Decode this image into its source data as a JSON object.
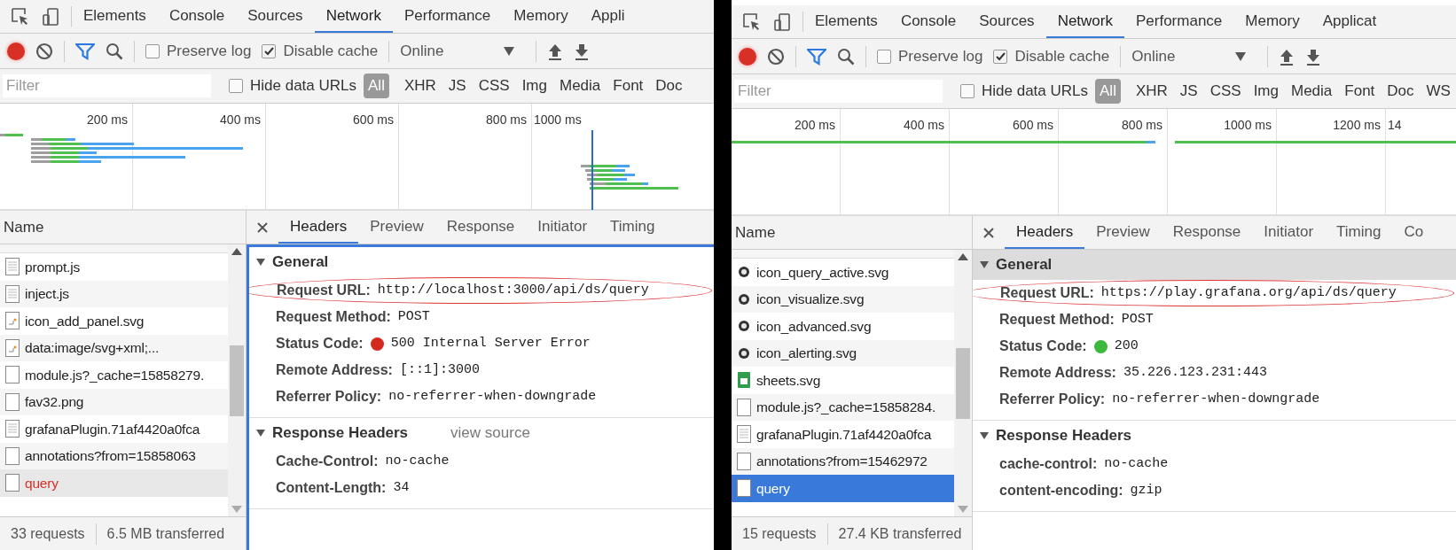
{
  "panels": [
    {
      "tabs": [
        {
          "label": "Elements",
          "selected": false
        },
        {
          "label": "Console",
          "selected": false
        },
        {
          "label": "Sources",
          "selected": false
        },
        {
          "label": "Network",
          "selected": true
        },
        {
          "label": "Performance",
          "selected": false
        },
        {
          "label": "Memory",
          "selected": false
        },
        {
          "label": "Appli",
          "selected": false
        }
      ],
      "toolbar": {
        "recording": true,
        "preserve_log": {
          "label": "Preserve log",
          "checked": false
        },
        "disable_cache": {
          "label": "Disable cache",
          "checked": true
        },
        "throttling": "Online"
      },
      "filter": {
        "placeholder": "Filter",
        "hide_data_urls": {
          "label": "Hide data URLs",
          "checked": false
        },
        "types": [
          {
            "label": "All",
            "selected": true
          },
          {
            "label": "XHR",
            "selected": false
          },
          {
            "label": "JS",
            "selected": false
          },
          {
            "label": "CSS",
            "selected": false
          },
          {
            "label": "Img",
            "selected": false
          },
          {
            "label": "Media",
            "selected": false
          },
          {
            "label": "Font",
            "selected": false
          },
          {
            "label": "Doc",
            "selected": false
          }
        ]
      },
      "timeline": {
        "ticks": [
          "200 ms",
          "400 ms",
          "600 ms",
          "800 ms",
          "1000 ms"
        ]
      },
      "requests": {
        "header": "Name",
        "focused": false,
        "rows": [
          {
            "name": "prompt.js",
            "kind": "script",
            "selected": false,
            "error": false
          },
          {
            "name": "inject.js",
            "kind": "script",
            "selected": false,
            "error": false
          },
          {
            "name": "icon_add_panel.svg",
            "kind": "image",
            "selected": false,
            "error": false
          },
          {
            "name": "data:image/svg+xml;...",
            "kind": "image",
            "selected": false,
            "error": false
          },
          {
            "name": "module.js?_cache=15858279.",
            "kind": "blank",
            "selected": false,
            "error": false
          },
          {
            "name": "fav32.png",
            "kind": "blank",
            "selected": false,
            "error": false
          },
          {
            "name": "grafanaPlugin.71af4420a0fca",
            "kind": "script",
            "selected": false,
            "error": false
          },
          {
            "name": "annotations?from=15858063",
            "kind": "blank",
            "selected": false,
            "error": false
          },
          {
            "name": "query",
            "kind": "blank",
            "selected": true,
            "error": true
          }
        ]
      },
      "footer": [
        "33 requests",
        "6.5 MB transferred"
      ],
      "details": {
        "tabs": [
          {
            "label": "Headers",
            "selected": true
          },
          {
            "label": "Preview",
            "selected": false
          },
          {
            "label": "Response",
            "selected": false
          },
          {
            "label": "Initiator",
            "selected": false
          },
          {
            "label": "Timing",
            "selected": false
          }
        ],
        "sections": [
          {
            "title": "General",
            "expanded": true,
            "highlighted": false,
            "fields": [
              {
                "label": "Request URL:",
                "value": "http://localhost:3000/api/ds/query",
                "circled": true
              },
              {
                "label": "Request Method:",
                "value": "POST",
                "circled": false
              },
              {
                "label": "Status Code:",
                "value": "500 Internal Server Error",
                "circled": false,
                "color": "#d42a1e"
              },
              {
                "label": "Remote Address:",
                "value": "[::1]:3000",
                "circled": false
              },
              {
                "label": "Referrer Policy:",
                "value": "no-referrer-when-downgrade",
                "circled": false
              }
            ]
          },
          {
            "title": "Response Headers",
            "expanded": true,
            "highlighted": false,
            "link": "view source",
            "fields": [
              {
                "label": "Cache-Control:",
                "value": "no-cache",
                "circled": false
              },
              {
                "label": "Content-Length:",
                "value": "34",
                "circled": false
              }
            ]
          }
        ]
      }
    },
    {
      "tabs": [
        {
          "label": "Elements",
          "selected": false
        },
        {
          "label": "Console",
          "selected": false
        },
        {
          "label": "Sources",
          "selected": false
        },
        {
          "label": "Network",
          "selected": true
        },
        {
          "label": "Performance",
          "selected": false
        },
        {
          "label": "Memory",
          "selected": false
        },
        {
          "label": "Applicat",
          "selected": false
        }
      ],
      "toolbar": {
        "recording": true,
        "preserve_log": {
          "label": "Preserve log",
          "checked": false
        },
        "disable_cache": {
          "label": "Disable cache",
          "checked": true
        },
        "throttling": "Online"
      },
      "filter": {
        "placeholder": "Filter",
        "hide_data_urls": {
          "label": "Hide data URLs",
          "checked": false
        },
        "types": [
          {
            "label": "All",
            "selected": true
          },
          {
            "label": "XHR",
            "selected": false
          },
          {
            "label": "JS",
            "selected": false
          },
          {
            "label": "CSS",
            "selected": false
          },
          {
            "label": "Img",
            "selected": false
          },
          {
            "label": "Media",
            "selected": false
          },
          {
            "label": "Font",
            "selected": false
          },
          {
            "label": "Doc",
            "selected": false
          },
          {
            "label": "WS",
            "selected": false
          }
        ]
      },
      "timeline": {
        "ticks": [
          "200 ms",
          "400 ms",
          "600 ms",
          "800 ms",
          "1000 ms",
          "1200 ms",
          "14"
        ]
      },
      "requests": {
        "header": "Name",
        "focused": true,
        "rows": [
          {
            "name": "icon_query_active.svg",
            "kind": "dot",
            "selected": false,
            "error": false
          },
          {
            "name": "icon_visualize.svg",
            "kind": "dot",
            "selected": false,
            "error": false
          },
          {
            "name": "icon_advanced.svg",
            "kind": "dot",
            "selected": false,
            "error": false
          },
          {
            "name": "icon_alerting.svg",
            "kind": "dot",
            "selected": false,
            "error": false
          },
          {
            "name": "sheets.svg",
            "kind": "sheet",
            "selected": false,
            "error": false
          },
          {
            "name": "module.js?_cache=15858284.",
            "kind": "blank",
            "selected": false,
            "error": false
          },
          {
            "name": "grafanaPlugin.71af4420a0fca",
            "kind": "script",
            "selected": false,
            "error": false
          },
          {
            "name": "annotations?from=15462972",
            "kind": "blank",
            "selected": false,
            "error": false
          },
          {
            "name": "query",
            "kind": "blank",
            "selected": true,
            "error": false
          }
        ]
      },
      "footer": [
        "15 requests",
        "27.4 KB transferred"
      ],
      "details": {
        "tabs": [
          {
            "label": "Headers",
            "selected": true
          },
          {
            "label": "Preview",
            "selected": false
          },
          {
            "label": "Response",
            "selected": false
          },
          {
            "label": "Initiator",
            "selected": false
          },
          {
            "label": "Timing",
            "selected": false
          },
          {
            "label": "Co",
            "selected": false
          }
        ],
        "sections": [
          {
            "title": "General",
            "expanded": true,
            "highlighted": true,
            "fields": [
              {
                "label": "Request URL:",
                "value": "https://play.grafana.org/api/ds/query",
                "circled": true
              },
              {
                "label": "Request Method:",
                "value": "POST",
                "circled": false
              },
              {
                "label": "Status Code:",
                "value": "200",
                "circled": false,
                "color": "#3cb83c"
              },
              {
                "label": "Remote Address:",
                "value": "35.226.123.231:443",
                "circled": false
              },
              {
                "label": "Referrer Policy:",
                "value": "no-referrer-when-downgrade",
                "circled": false
              }
            ]
          },
          {
            "title": "Response Headers",
            "expanded": true,
            "highlighted": false,
            "fields": [
              {
                "label": "cache-control:",
                "value": "no-cache",
                "circled": false
              },
              {
                "label": "content-encoding:",
                "value": "gzip",
                "circled": false
              }
            ]
          }
        ]
      }
    }
  ]
}
